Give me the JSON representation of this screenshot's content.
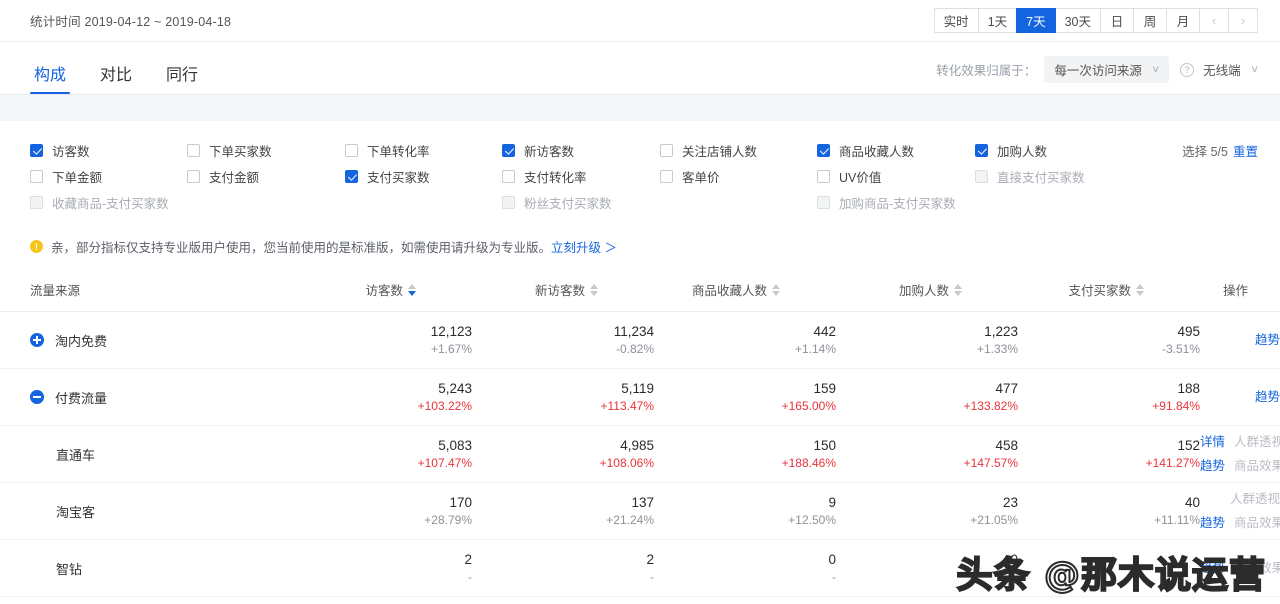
{
  "header": {
    "stat_time_label": "统计时间 2019-04-12 ~ 2019-04-18",
    "date_buttons": [
      {
        "label": "实时",
        "active": false
      },
      {
        "label": "1天",
        "active": false
      },
      {
        "label": "7天",
        "active": true
      },
      {
        "label": "30天",
        "active": false
      },
      {
        "label": "日",
        "active": false
      },
      {
        "label": "周",
        "active": false
      },
      {
        "label": "月",
        "active": false
      }
    ],
    "prev_arrow": "‹",
    "next_arrow": "›"
  },
  "tabs": [
    {
      "label": "构成",
      "active": true
    },
    {
      "label": "对比",
      "active": false
    },
    {
      "label": "同行",
      "active": false
    }
  ],
  "attribution": {
    "label": "转化效果归属于：",
    "selected": "每一次访问来源",
    "help_icon": "?",
    "terminal": "无线端",
    "caret": "∨"
  },
  "metrics": {
    "select_count_text": "选择 5/5",
    "reset_label": "重置",
    "rows": [
      [
        {
          "label": "访客数",
          "state": "checked"
        },
        {
          "label": "下单买家数",
          "state": "unchecked"
        },
        {
          "label": "下单转化率",
          "state": "unchecked"
        },
        {
          "label": "新访客数",
          "state": "checked"
        },
        {
          "label": "关注店铺人数",
          "state": "unchecked"
        },
        {
          "label": "商品收藏人数",
          "state": "checked"
        },
        {
          "label": "加购人数",
          "state": "checked"
        }
      ],
      [
        {
          "label": "下单金额",
          "state": "unchecked"
        },
        {
          "label": "支付金额",
          "state": "unchecked"
        },
        {
          "label": "支付买家数",
          "state": "checked"
        },
        {
          "label": "支付转化率",
          "state": "unchecked"
        },
        {
          "label": "客单价",
          "state": "unchecked"
        },
        {
          "label": "UV价值",
          "state": "unchecked"
        },
        {
          "label": "直接支付买家数",
          "state": "disabled"
        }
      ],
      [
        {
          "label": "收藏商品-支付买家数",
          "state": "disabled"
        },
        {
          "label": "",
          "state": "empty"
        },
        {
          "label": "",
          "state": "empty"
        },
        {
          "label": "粉丝支付买家数",
          "state": "disabled"
        },
        {
          "label": "",
          "state": "empty"
        },
        {
          "label": "加购商品-支付买家数",
          "state": "disabled"
        },
        {
          "label": "",
          "state": "empty"
        }
      ]
    ]
  },
  "notice": {
    "icon": "!",
    "text": "亲，部分指标仅支持专业版用户使用，您当前使用的是标准版，如需使用请升级为专业版。",
    "link": "立刻升级 ＞"
  },
  "table": {
    "columns": [
      {
        "label": "流量来源",
        "sort": "none"
      },
      {
        "label": "访客数",
        "sort": "desc"
      },
      {
        "label": "新访客数",
        "sort": "none"
      },
      {
        "label": "商品收藏人数",
        "sort": "none"
      },
      {
        "label": "加购人数",
        "sort": "none"
      },
      {
        "label": "支付买家数",
        "sort": "none"
      },
      {
        "label": "操作",
        "sort": "none"
      }
    ],
    "rows": [
      {
        "name": "淘内免费",
        "expander": "plus",
        "indent": false,
        "values": [
          {
            "num": "12,123",
            "delta": "+1.67%",
            "tone": "neutral"
          },
          {
            "num": "11,234",
            "delta": "-0.82%",
            "tone": "neutral"
          },
          {
            "num": "442",
            "delta": "+1.14%",
            "tone": "neutral"
          },
          {
            "num": "1,223",
            "delta": "+1.33%",
            "tone": "neutral"
          },
          {
            "num": "495",
            "delta": "-3.51%",
            "tone": "neutral"
          }
        ],
        "ops_top": [],
        "ops_bottom": [
          {
            "label": "趋势",
            "disabled": false
          }
        ]
      },
      {
        "name": "付费流量",
        "expander": "minus",
        "indent": false,
        "values": [
          {
            "num": "5,243",
            "delta": "+103.22%",
            "tone": "up"
          },
          {
            "num": "5,119",
            "delta": "+113.47%",
            "tone": "up"
          },
          {
            "num": "159",
            "delta": "+165.00%",
            "tone": "up"
          },
          {
            "num": "477",
            "delta": "+133.82%",
            "tone": "up"
          },
          {
            "num": "188",
            "delta": "+91.84%",
            "tone": "up"
          }
        ],
        "ops_top": [],
        "ops_bottom": [
          {
            "label": "趋势",
            "disabled": false
          }
        ]
      },
      {
        "name": "直通车",
        "expander": "none",
        "indent": true,
        "values": [
          {
            "num": "5,083",
            "delta": "+107.47%",
            "tone": "up"
          },
          {
            "num": "4,985",
            "delta": "+108.06%",
            "tone": "up"
          },
          {
            "num": "150",
            "delta": "+188.46%",
            "tone": "up"
          },
          {
            "num": "458",
            "delta": "+147.57%",
            "tone": "up"
          },
          {
            "num": "152",
            "delta": "+141.27%",
            "tone": "up"
          }
        ],
        "ops_top": [
          {
            "label": "详情",
            "disabled": false
          },
          {
            "label": "人群透视",
            "disabled": true
          }
        ],
        "ops_bottom": [
          {
            "label": "趋势",
            "disabled": false
          },
          {
            "label": "商品效果",
            "disabled": true
          }
        ]
      },
      {
        "name": "淘宝客",
        "expander": "none",
        "indent": true,
        "values": [
          {
            "num": "170",
            "delta": "+28.79%",
            "tone": "neutral"
          },
          {
            "num": "137",
            "delta": "+21.24%",
            "tone": "neutral"
          },
          {
            "num": "9",
            "delta": "+12.50%",
            "tone": "neutral"
          },
          {
            "num": "23",
            "delta": "+21.05%",
            "tone": "neutral"
          },
          {
            "num": "40",
            "delta": "+11.11%",
            "tone": "neutral"
          }
        ],
        "ops_top": [
          {
            "label": "人群透视",
            "disabled": true
          }
        ],
        "ops_bottom": [
          {
            "label": "趋势",
            "disabled": false
          },
          {
            "label": "商品效果",
            "disabled": true
          }
        ]
      },
      {
        "name": "智钻",
        "expander": "none",
        "indent": true,
        "values": [
          {
            "num": "2",
            "delta": "-",
            "tone": "none"
          },
          {
            "num": "2",
            "delta": "-",
            "tone": "none"
          },
          {
            "num": "0",
            "delta": "-",
            "tone": "none"
          },
          {
            "num": "0",
            "delta": "-",
            "tone": "none"
          },
          {
            "num": "",
            "delta": "",
            "tone": "none"
          }
        ],
        "ops_top": [],
        "ops_bottom": [
          {
            "label": "趋势",
            "disabled": false
          },
          {
            "label": "商品效果",
            "disabled": true
          }
        ]
      }
    ]
  },
  "watermark": "头条 @那木说运营",
  "colors": {
    "accent": "#1464e0",
    "up": "#e8343c",
    "neutral": "#8d9199",
    "warn": "#f5c518"
  }
}
